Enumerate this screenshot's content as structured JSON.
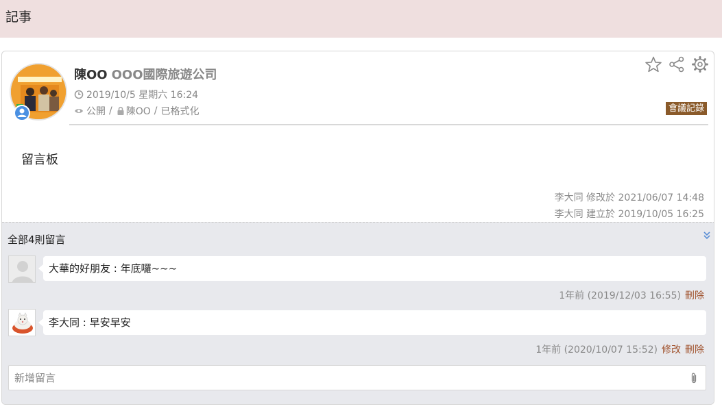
{
  "page": {
    "title": "記事"
  },
  "post": {
    "author": "陳OO",
    "company": "OOO國際旅遊公司",
    "date": "2019/10/5  星期六  16:24",
    "visibility": "公開",
    "owner": "陳OO",
    "status": "已格式化",
    "separator": "/",
    "category": "會議記錄",
    "content": "留言板",
    "modified": "李大同 修改於 2021/06/07 14:48",
    "created": "李大同 建立於 2019/10/05 16:25"
  },
  "comments": {
    "count_label": "全部4則留言",
    "items": [
      {
        "text": "大華的好朋友 : 年底囉~~~",
        "time": "1年前 (2019/12/03 16:55)",
        "edit": "",
        "delete": "刪除"
      },
      {
        "text": "李大同 : 早安早安",
        "time": "1年前 (2020/10/07 15:52)",
        "edit": "修改",
        "delete": "刪除"
      }
    ],
    "new_placeholder": "新增留言"
  },
  "colors": {
    "topbar": "#efdfdf",
    "category": "#8a5a2a",
    "action": "#a0522d",
    "comment_bg": "#e8e9ed"
  },
  "icons": [
    "star-icon",
    "share-icon",
    "gear-icon",
    "clock-icon",
    "eye-icon",
    "lock-icon",
    "expand-icon",
    "paperclip-icon"
  ]
}
